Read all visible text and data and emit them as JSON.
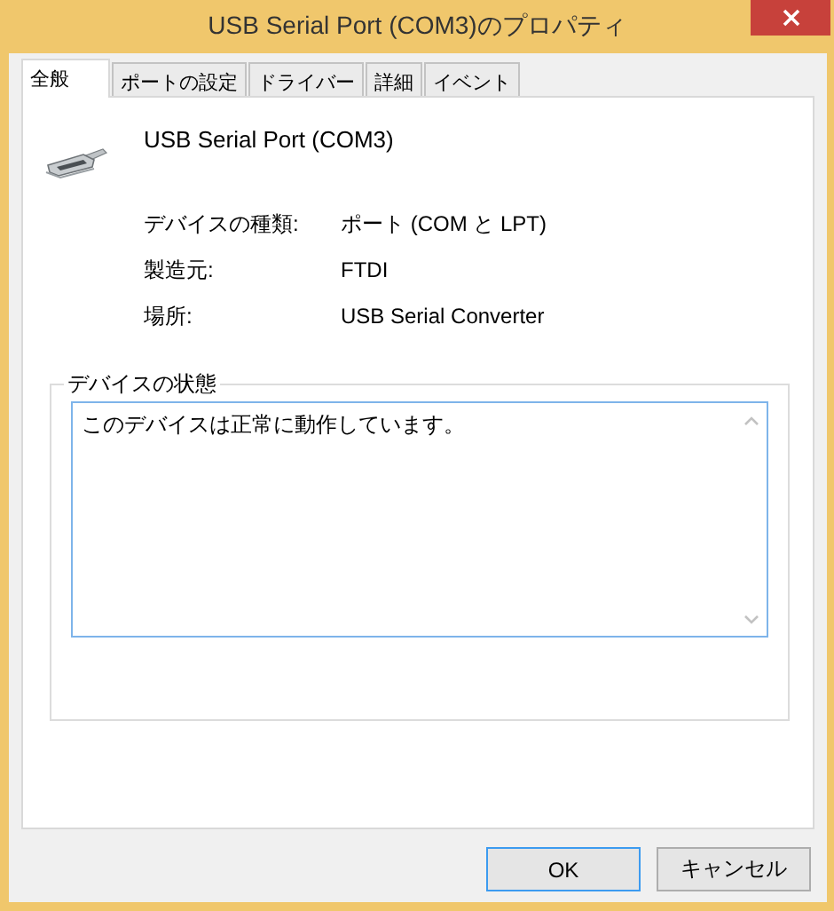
{
  "window": {
    "title": "USB Serial Port (COM3)のプロパティ"
  },
  "tabs": [
    {
      "label": "全般",
      "selected": true
    },
    {
      "label": "ポートの設定",
      "selected": false
    },
    {
      "label": "ドライバー",
      "selected": false
    },
    {
      "label": "詳細",
      "selected": false
    },
    {
      "label": "イベント",
      "selected": false
    }
  ],
  "device": {
    "name": "USB Serial Port (COM3)"
  },
  "properties": [
    {
      "label": "デバイスの種類:",
      "value": "ポート (COM と LPT)"
    },
    {
      "label": "製造元:",
      "value": "FTDI"
    },
    {
      "label": "場所:",
      "value": "USB Serial Converter"
    }
  ],
  "status": {
    "title": "デバイスの状態",
    "text": "このデバイスは正常に動作しています。"
  },
  "buttons": [
    {
      "label": "OK",
      "default": true
    },
    {
      "label": "キャンセル",
      "default": false
    }
  ]
}
